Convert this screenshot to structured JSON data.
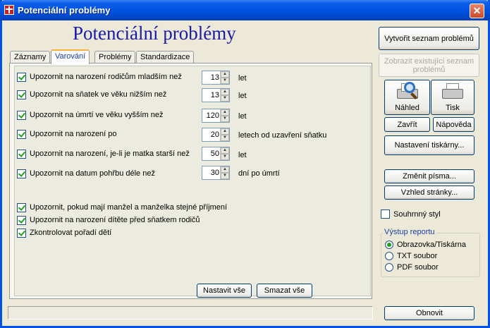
{
  "window": {
    "title": "Potenciální problémy",
    "close_glyph": "✕"
  },
  "heading": "Potenciální problémy",
  "tabs": [
    {
      "label": "Záznamy",
      "active": false
    },
    {
      "label": "Varování",
      "active": true
    },
    {
      "label": "Problémy",
      "active": false
    },
    {
      "label": "Standardizace",
      "active": false
    }
  ],
  "warnings": [
    {
      "label": "Upozornit na narození rodičům mladším než",
      "checked": true,
      "value": "13",
      "unit": "let"
    },
    {
      "label": "Upozornit na sňatek ve věku nižším než",
      "checked": true,
      "value": "13",
      "unit": "let"
    },
    {
      "label": "Upozornit na úmrtí ve věku vyšším než",
      "checked": true,
      "value": "120",
      "unit": "let"
    },
    {
      "label": "Upozornit na narození po",
      "checked": true,
      "value": "20",
      "unit": "letech od uzavření sňatku"
    },
    {
      "label": "Upozornit na narození, je-li je matka starší než",
      "checked": true,
      "value": "50",
      "unit": "let"
    },
    {
      "label": "Upozornit na datum pohřbu déle než",
      "checked": true,
      "value": "30",
      "unit": "dní po úmrtí"
    }
  ],
  "extra_checks": [
    {
      "label": "Upozornit, pokud mají manžel a manželka stejné příjmení",
      "checked": true
    },
    {
      "label": "Upozornit na narození dítěte před sňatkem rodičů",
      "checked": true
    },
    {
      "label": "Zkontrolovat pořadí dětí",
      "checked": true
    }
  ],
  "panel_buttons": {
    "set_all": "Nastavit vše",
    "clear_all": "Smazat vše"
  },
  "side": {
    "create_list": "Vytvořit seznam problémů",
    "show_existing": "Zobrazit existující seznam problémů",
    "preview": "Náhled",
    "print": "Tisk",
    "close": "Zavřít",
    "help": "Nápověda",
    "printer_settings": "Nastavení tiskárny...",
    "change_font": "Změnit písma...",
    "page_layout": "Vzhled stránky...",
    "summary_style": "Souhrnný styl",
    "refresh": "Obnovit"
  },
  "report_output": {
    "title": "Výstup reportu",
    "options": [
      "Obrazovka/Tiskárna",
      "TXT soubor",
      "PDF soubor"
    ],
    "selected": "Obrazovka/Tiskárna"
  },
  "icons": {
    "app": "app-icon",
    "preview": "magnifier-icon",
    "print": "printer-icon"
  }
}
